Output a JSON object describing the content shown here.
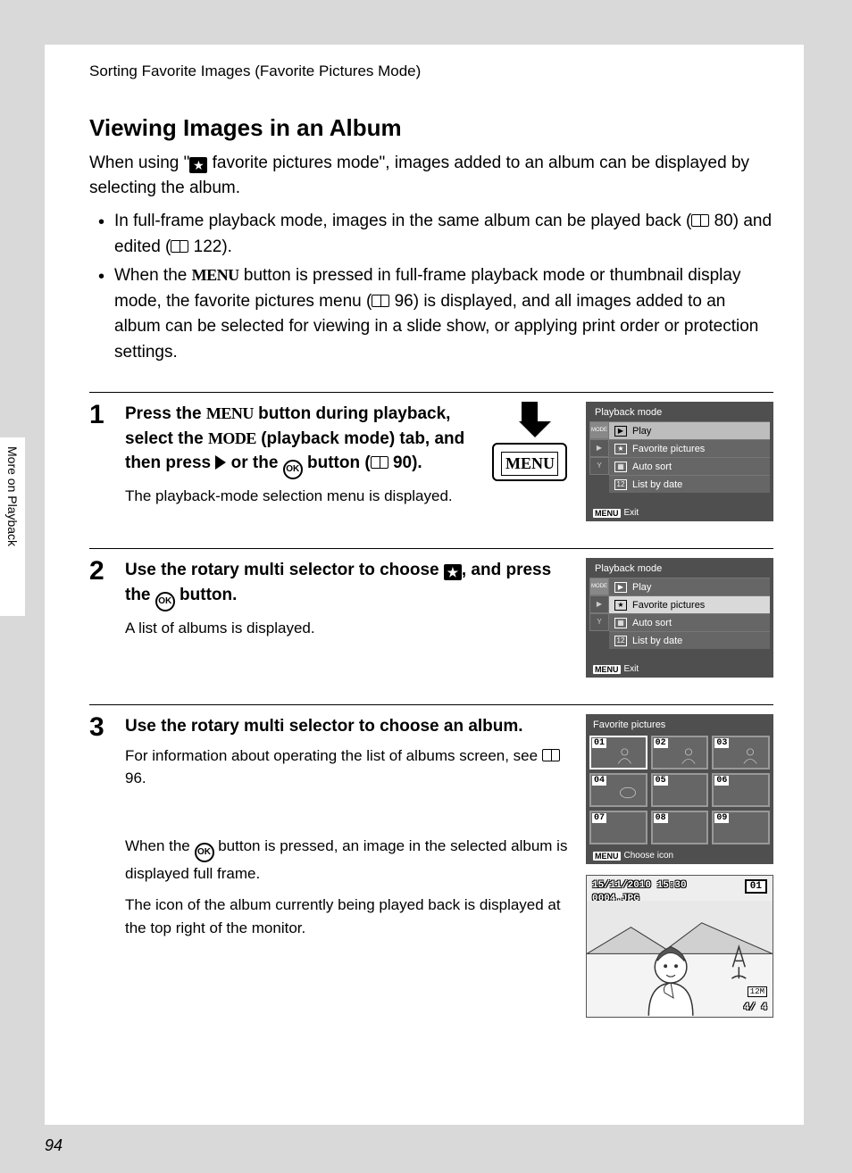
{
  "breadcrumb": "Sorting Favorite Images (Favorite Pictures Mode)",
  "section_title": "Viewing Images in an Album",
  "intro_pre": "When using \"",
  "intro_post": " favorite pictures mode\", images added to an album can be displayed by selecting the album.",
  "bullets": [
    {
      "pre": "In full-frame playback mode, images in the same album can be played back (",
      "ref1": " 80) and edited (",
      "ref2": " 122)."
    },
    {
      "pre": "When the ",
      "mid": " button is pressed in full-frame playback mode or thumbnail display mode, the favorite pictures menu (",
      "ref1": " 96) is displayed, and all images added to an album can be selected for viewing in a slide show, or applying print order or protection settings."
    }
  ],
  "step1": {
    "num": "1",
    "head_a": "Press the ",
    "head_b": " button during playback, select the ",
    "head_c": " (playback mode) tab, and then press ",
    "head_d": " or the ",
    "head_e": " button (",
    "head_f": " 90).",
    "sub": "The playback-mode selection menu is displayed.",
    "menu_label": "MENU",
    "lcd_title": "Playback mode",
    "items": [
      {
        "label": "Play",
        "sel": true
      },
      {
        "label": "Favorite pictures"
      },
      {
        "label": "Auto sort"
      },
      {
        "label": "List by date"
      }
    ],
    "exit": "Exit",
    "mode_tab": "MODE"
  },
  "step2": {
    "num": "2",
    "head_a": "Use the rotary multi selector to choose ",
    "head_b": ", and press the ",
    "head_c": " button.",
    "sub": "A list of albums is displayed.",
    "lcd_title": "Playback mode",
    "items": [
      {
        "label": "Play"
      },
      {
        "label": "Favorite pictures",
        "sel": true
      },
      {
        "label": "Auto sort"
      },
      {
        "label": "List by date"
      }
    ],
    "exit": "Exit",
    "mode_tab": "MODE"
  },
  "step3": {
    "num": "3",
    "head": "Use the rotary multi selector to choose an album.",
    "sub_a": "For information about operating the list of albums screen, see ",
    "sub_b": " 96.",
    "sub2_a": "When the ",
    "sub2_b": " button is pressed, an image in the selected album is displayed full frame.",
    "sub3": "The icon of the album currently being played back is displayed at the top right of the monitor.",
    "fav_title": "Favorite pictures",
    "fav_nums": [
      "01",
      "02",
      "03",
      "04",
      "05",
      "06",
      "07",
      "08",
      "09"
    ],
    "fav_foot": "Choose icon",
    "photo_date": "15/11/2010 15:30",
    "photo_file": "0004.JPG",
    "photo_album": "01",
    "photo_res": "12M",
    "photo_counter": "4/     4"
  },
  "side_tab": "More on Playback",
  "page_number": "94",
  "ok_label": "OK",
  "menu_badge": "MENU"
}
